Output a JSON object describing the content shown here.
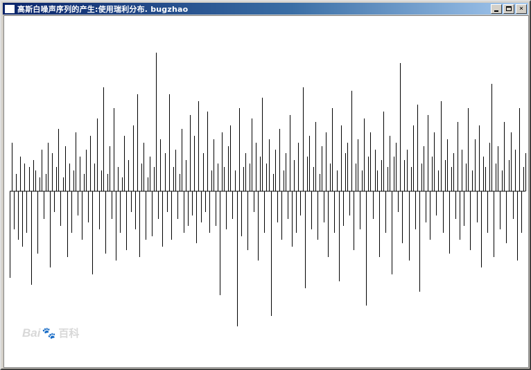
{
  "window": {
    "title": "高斯白噪声序列的产生:使用瑞利分布. bugzhao",
    "controls": {
      "minimize_icon": "minimize-icon",
      "maximize_icon": "maximize-icon",
      "close_glyph": "×"
    }
  },
  "watermark": {
    "text_latin": "Bai",
    "paw_glyph": "🐾",
    "text_cn": "百科",
    "kind": "logo"
  },
  "colors": {
    "titlebar_start": "#0a246a",
    "titlebar_end": "#a6caf0",
    "line": "#000000",
    "background": "#ffffff"
  },
  "chart_data": {
    "type": "line",
    "description_style": "vertical spikes from a horizontal baseline",
    "series": [
      {
        "values": [
          -125,
          70,
          -55,
          25,
          -70,
          50,
          -80,
          40,
          -60,
          35,
          -135,
          45,
          30,
          -90,
          20,
          60,
          -40,
          25,
          70,
          -110,
          55,
          -30,
          35,
          90,
          -50,
          20,
          65,
          -95,
          40,
          -60,
          30,
          85,
          -35,
          50,
          -70,
          25,
          60,
          -45,
          80,
          -120,
          40,
          105,
          -55,
          30,
          150,
          -90,
          25,
          65,
          -40,
          120,
          -100,
          35,
          -60,
          20,
          80,
          -85,
          45,
          -30,
          95,
          -55,
          140,
          -95,
          40,
          70,
          -70,
          20,
          50,
          -65,
          35,
          200,
          -40,
          75,
          -80,
          55,
          -30,
          140,
          -70,
          35,
          60,
          -40,
          25,
          90,
          -60,
          45,
          -50,
          110,
          -35,
          80,
          -75,
          130,
          -45,
          55,
          -30,
          115,
          -60,
          30,
          75,
          -50,
          40,
          -150,
          85,
          35,
          -55,
          65,
          95,
          -40,
          30,
          -195,
          120,
          -65,
          35,
          55,
          -85,
          40,
          105,
          -30,
          70,
          -100,
          50,
          135,
          -60,
          40,
          75,
          -180,
          25,
          60,
          -45,
          90,
          -70,
          30,
          55,
          -40,
          110,
          -80,
          45,
          -60,
          70,
          -35,
          150,
          -140,
          50,
          80,
          -55,
          35,
          100,
          -70,
          25,
          65,
          -45,
          85,
          -95,
          40,
          120,
          -60,
          30,
          -130,
          95,
          -50,
          55,
          70,
          -35,
          145,
          -85,
          40,
          75,
          -55,
          30,
          105,
          -165,
          50,
          85,
          -40,
          60,
          30,
          -95,
          45,
          115,
          -60,
          35,
          80,
          -120,
          50,
          70,
          -30,
          185,
          -75,
          45,
          60,
          -100,
          35,
          95,
          -55,
          125,
          -145,
          40,
          65,
          -45,
          110,
          -70,
          50,
          85,
          -35,
          30,
          130,
          -60,
          45,
          75,
          -90,
          35,
          55,
          -40,
          100,
          -70,
          60,
          -50,
          40,
          120,
          -85,
          30,
          75,
          -45,
          95,
          -110,
          50,
          35,
          -60,
          70,
          155,
          -95,
          40,
          65,
          -55,
          30,
          100,
          -75,
          45,
          85,
          -40,
          60,
          -100,
          120,
          -60,
          35,
          55
        ]
      }
    ]
  }
}
